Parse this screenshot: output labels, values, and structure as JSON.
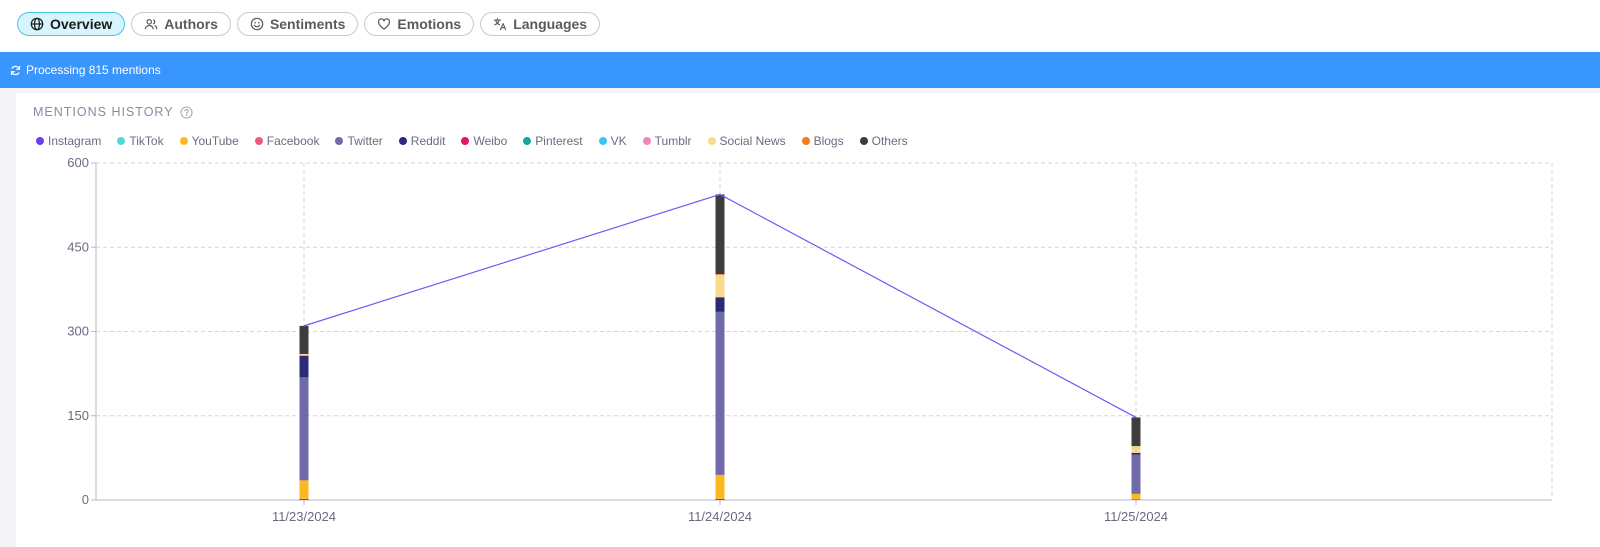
{
  "tabs": [
    {
      "label": "Overview",
      "icon": "globe-icon",
      "active": true
    },
    {
      "label": "Authors",
      "icon": "users-icon",
      "active": false
    },
    {
      "label": "Sentiments",
      "icon": "smile-icon",
      "active": false
    },
    {
      "label": "Emotions",
      "icon": "heart-icon",
      "active": false
    },
    {
      "label": "Languages",
      "icon": "translate-icon",
      "active": false
    }
  ],
  "banner": {
    "text": "Processing 815 mentions",
    "icon": "refresh-icon",
    "color": "#3a96ff"
  },
  "section": {
    "title": "MENTIONS HISTORY",
    "help_icon": "question-circle-icon"
  },
  "legend": [
    {
      "name": "Instagram",
      "color": "#6a3ef0"
    },
    {
      "name": "TikTok",
      "color": "#4fd6e0"
    },
    {
      "name": "YouTube",
      "color": "#fbb820"
    },
    {
      "name": "Facebook",
      "color": "#ef5b80"
    },
    {
      "name": "Twitter",
      "color": "#6f6aa8"
    },
    {
      "name": "Reddit",
      "color": "#2c2a78"
    },
    {
      "name": "Weibo",
      "color": "#e5136b"
    },
    {
      "name": "Pinterest",
      "color": "#14a89a"
    },
    {
      "name": "VK",
      "color": "#3fc4f0"
    },
    {
      "name": "Tumblr",
      "color": "#ef88b8"
    },
    {
      "name": "Social News",
      "color": "#f8d98e"
    },
    {
      "name": "Blogs",
      "color": "#f77b1b"
    },
    {
      "name": "Others",
      "color": "#3f3c3c"
    }
  ],
  "chart_data": {
    "type": "bar",
    "stacked": true,
    "overlay": "line",
    "line_color": "#6a5cf7",
    "categories": [
      "11/23/2024",
      "11/24/2024",
      "11/25/2024"
    ],
    "ylim": [
      0,
      600
    ],
    "yticks": [
      0,
      150,
      300,
      450,
      600
    ],
    "grid": true,
    "legend_position": "top-left",
    "series": [
      {
        "name": "Instagram",
        "values": [
          2,
          2,
          1
        ]
      },
      {
        "name": "YouTube",
        "values": [
          33,
          42,
          10
        ]
      },
      {
        "name": "Facebook",
        "values": [
          0,
          1,
          0
        ]
      },
      {
        "name": "Twitter",
        "values": [
          184,
          290,
          70
        ]
      },
      {
        "name": "Reddit",
        "values": [
          38,
          26,
          3
        ]
      },
      {
        "name": "Social News",
        "values": [
          3,
          40,
          12
        ]
      },
      {
        "name": "Blogs",
        "values": [
          0,
          1,
          0
        ]
      },
      {
        "name": "Others",
        "values": [
          50,
          142,
          51
        ]
      }
    ],
    "totals": [
      310,
      544,
      147
    ]
  }
}
